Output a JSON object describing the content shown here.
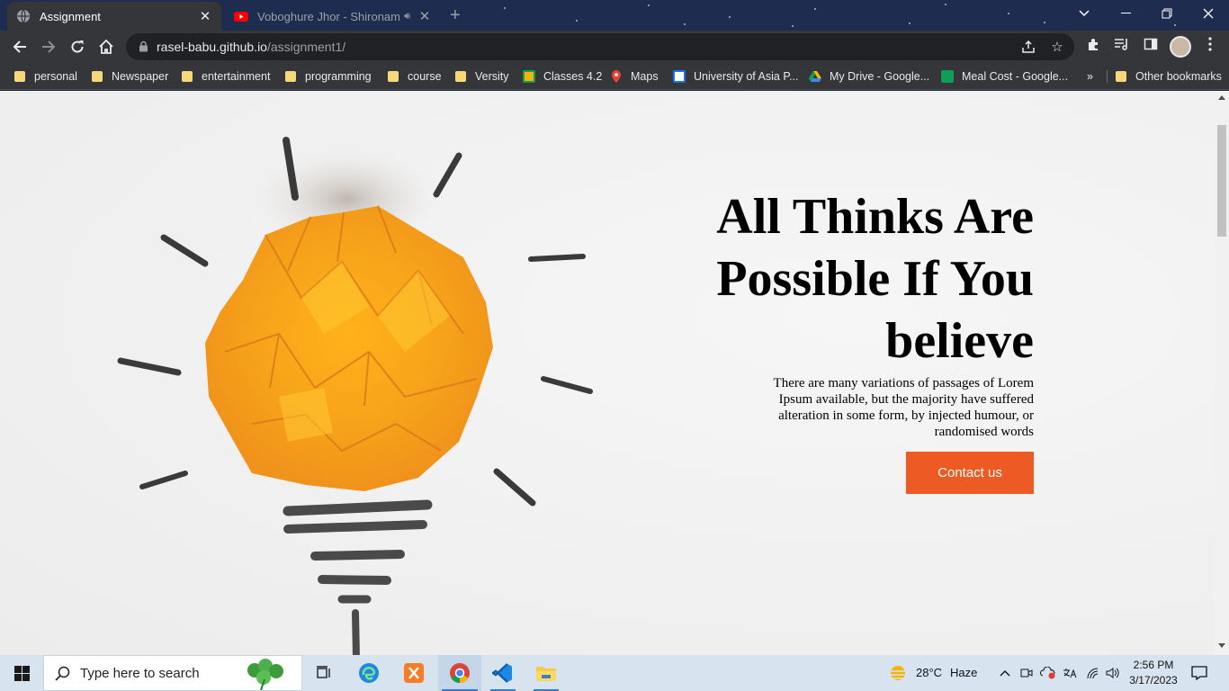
{
  "browser": {
    "tabs": [
      {
        "title": "Assignment",
        "active": true,
        "favicon": "globe-icon"
      },
      {
        "title": "Voboghure Jhor - Shironamhin",
        "active": false,
        "favicon": "youtube-icon",
        "audio": "speaker-icon"
      }
    ],
    "new_tab_label": "+",
    "url_host": "rasel-babu.github.io",
    "url_path": "/assignment1/"
  },
  "bookmarks": [
    {
      "label": "personal",
      "icon": "folder-icon"
    },
    {
      "label": "Newspaper",
      "icon": "folder-icon"
    },
    {
      "label": "entertainment",
      "icon": "folder-icon"
    },
    {
      "label": "programming",
      "icon": "folder-icon"
    },
    {
      "label": "course",
      "icon": "folder-icon"
    },
    {
      "label": "Versity",
      "icon": "folder-icon"
    },
    {
      "label": "Classes 4.2",
      "icon": "classroom-icon"
    },
    {
      "label": "Maps",
      "icon": "maps-icon"
    },
    {
      "label": "University of Asia P...",
      "icon": "university-icon"
    },
    {
      "label": "My Drive - Google...",
      "icon": "drive-icon"
    },
    {
      "label": "Meal Cost - Google...",
      "icon": "sheets-icon"
    }
  ],
  "bookmarks_more": "»",
  "other_bookmarks": "Other bookmarks",
  "hero": {
    "headline": "All Thinks Are Possible If You believe",
    "subtext": "There are many variations of passages of Lorem Ipsum available, but the majority have suffered alteration in some form, by injected humour, or randomised words",
    "button_label": "Contact us",
    "accent_color": "#ed5a24"
  },
  "taskbar": {
    "search_placeholder": "Type here to search",
    "weather_temp": "28°C",
    "weather_desc": "Haze",
    "time": "2:56 PM",
    "date": "3/17/2023"
  }
}
